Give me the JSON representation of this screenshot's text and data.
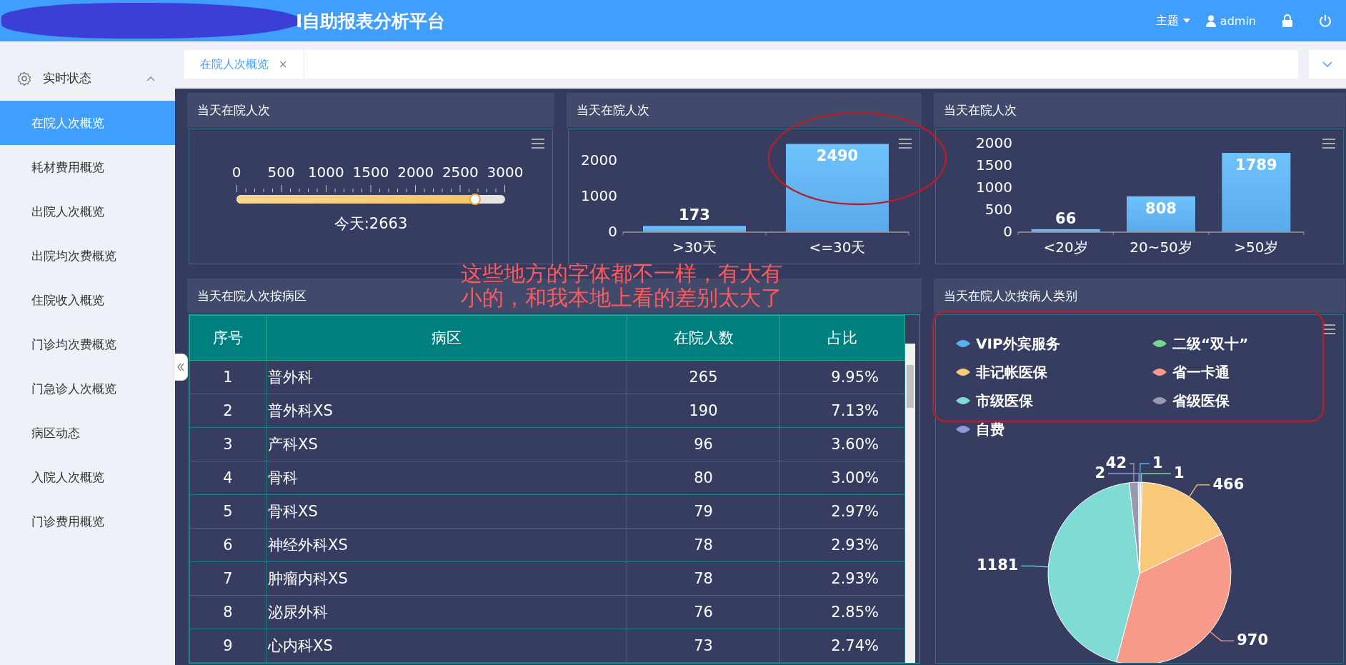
{
  "header": {
    "title": "I自助报表分析平台",
    "theme_menu": "主题",
    "user": "admin"
  },
  "sidebar": {
    "group": {
      "label": "实时状态",
      "expanded": true
    },
    "items": [
      {
        "label": "在院人次概览",
        "selected": true
      },
      {
        "label": "耗材费用概览",
        "selected": false
      },
      {
        "label": "出院人次概览",
        "selected": false
      },
      {
        "label": "出院均次费概览",
        "selected": false
      },
      {
        "label": "住院收入概览",
        "selected": false
      },
      {
        "label": "门诊均次费概览",
        "selected": false
      },
      {
        "label": "门急诊人次概览",
        "selected": false
      },
      {
        "label": "病区动态",
        "selected": false
      },
      {
        "label": "入院人次概览",
        "selected": false
      },
      {
        "label": "门诊费用概览",
        "selected": false
      }
    ]
  },
  "tabs": [
    {
      "label": "在院人次概览",
      "selected": true,
      "close": "×"
    }
  ],
  "gauge_panel": {
    "title": "当天在院人次",
    "ticks": [
      "0",
      "500",
      "1000",
      "1500",
      "2000",
      "2500",
      "3000"
    ],
    "level": 0.8877,
    "reading": "今天:2663"
  },
  "bar_panels": [
    {
      "title": "当天在院人次",
      "chart_data": {
        "type": "bar",
        "categories": [
          ">30天",
          "<=30天"
        ],
        "values": [
          173,
          2490
        ],
        "ylim": [
          0,
          2500
        ],
        "yticks": [
          0,
          1000,
          2000
        ],
        "data_labels": true
      }
    },
    {
      "title": "当天在院人次",
      "chart_data": {
        "type": "bar",
        "categories": [
          "<20岁",
          "20~50岁",
          ">50岁"
        ],
        "values": [
          66,
          808,
          1789
        ],
        "ylim": [
          0,
          2000
        ],
        "yticks": [
          0,
          500,
          1000,
          1500,
          2000
        ],
        "data_labels": true
      }
    }
  ],
  "table_panel": {
    "title": "当天在院人次按病区",
    "columns": [
      "序号",
      "病区",
      "在院人数",
      "占比"
    ],
    "rows": [
      [
        "1",
        "普外科",
        "265",
        "9.95%"
      ],
      [
        "2",
        "普外科XS",
        "190",
        "7.13%"
      ],
      [
        "3",
        "产科XS",
        "96",
        "3.60%"
      ],
      [
        "4",
        "骨科",
        "80",
        "3.00%"
      ],
      [
        "5",
        "骨科XS",
        "79",
        "2.97%"
      ],
      [
        "6",
        "神经外科XS",
        "78",
        "2.93%"
      ],
      [
        "7",
        "肿瘤内科XS",
        "78",
        "2.93%"
      ],
      [
        "8",
        "泌尿外科",
        "76",
        "2.85%"
      ],
      [
        "9",
        "心内科XS",
        "73",
        "2.74%"
      ]
    ]
  },
  "pie_panel": {
    "title": "当天在院人次按病人类别",
    "legend": [
      {
        "color": "#5ab1ef"
      },
      {
        "color": "#71d98c"
      },
      {
        "color": "#f7c978"
      },
      {
        "color": "#f79a8a"
      },
      {
        "color": "#7fdbd3"
      },
      {
        "color": "#9a9aae"
      },
      {
        "color": "#8d98d6"
      }
    ],
    "chart_data": {
      "type": "pie",
      "categories": [
        "VIP外宾服务",
        "二级“双十”",
        "非记帐医保",
        "省一卡通",
        "市级医保",
        "省级医保",
        "自费"
      ],
      "values": [
        1,
        1,
        466,
        970,
        1181,
        42,
        2
      ],
      "data_labels": true
    }
  },
  "annotation": {
    "lines": [
      "这些地方的字体都不一样，有大有",
      "小的，和我本地上看的差别太大了"
    ]
  }
}
